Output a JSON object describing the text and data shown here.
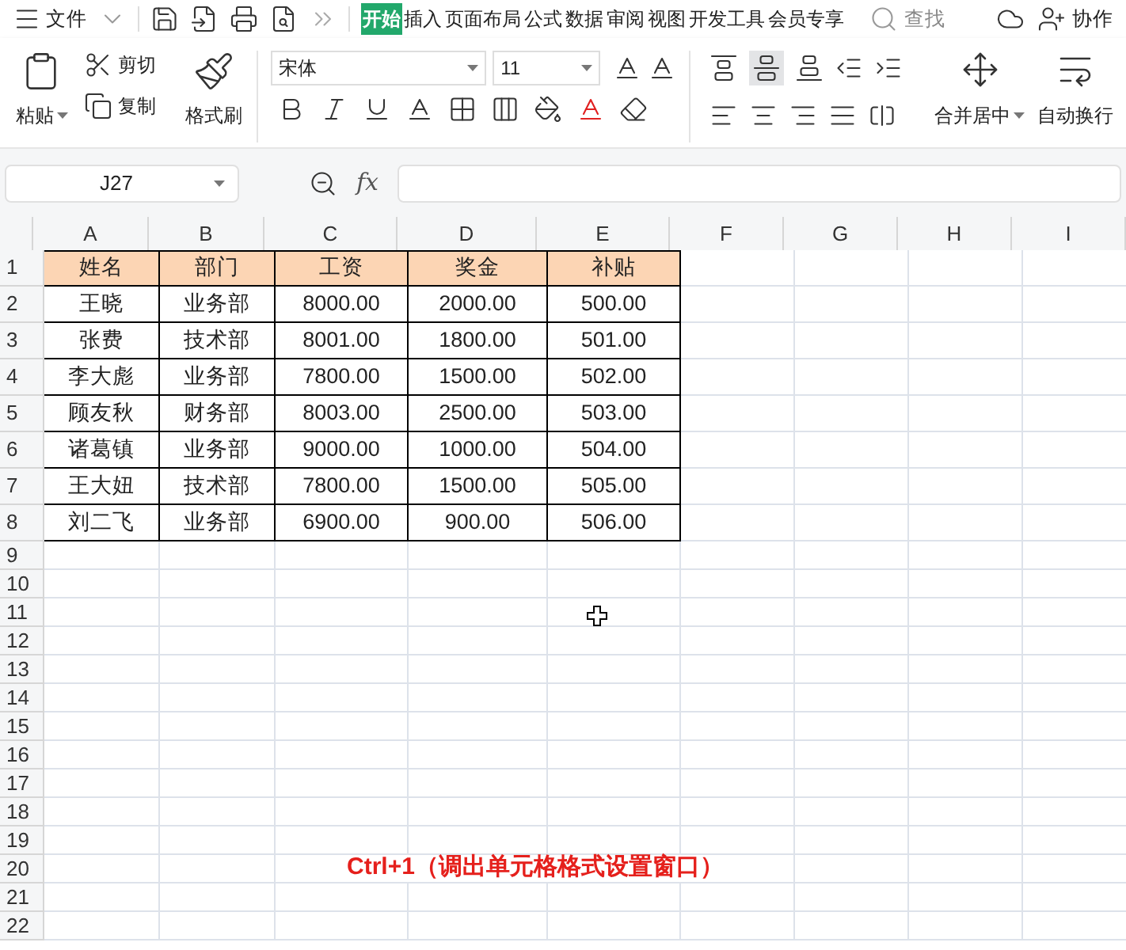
{
  "menu": {
    "file": "文件",
    "tabs": [
      {
        "label": "开始",
        "selected": true
      },
      {
        "label": "插入",
        "selected": false
      },
      {
        "label": "页面布局",
        "selected": false
      },
      {
        "label": "公式",
        "selected": false
      },
      {
        "label": "数据",
        "selected": false
      },
      {
        "label": "审阅",
        "selected": false
      },
      {
        "label": "视图",
        "selected": false
      },
      {
        "label": "开发工具",
        "selected": false
      },
      {
        "label": "会员专享",
        "selected": false
      }
    ],
    "search": "查找",
    "collab": "协作"
  },
  "ribbon": {
    "paste": "粘贴",
    "cut": "剪切",
    "copy": "复制",
    "format_painter": "格式刷",
    "font": "宋体",
    "size": "11",
    "merge": "合并居中",
    "wrap": "自动换行"
  },
  "formula_bar": {
    "name_box": "J27",
    "fx": "fx"
  },
  "sheet": {
    "columns": [
      "A",
      "B",
      "C",
      "D",
      "E",
      "F",
      "G",
      "H",
      "I"
    ],
    "row_numbers": [
      "1",
      "2",
      "3",
      "4",
      "5",
      "6",
      "7",
      "8",
      "9",
      "10",
      "11",
      "12",
      "13",
      "14",
      "15",
      "16",
      "17",
      "18",
      "19",
      "20",
      "21",
      "22"
    ],
    "header": [
      "姓名",
      "部门",
      "工资",
      "奖金",
      "补贴"
    ],
    "rows": [
      [
        "王晓",
        "业务部",
        "8000.00",
        "2000.00",
        "500.00"
      ],
      [
        "张费",
        "技术部",
        "8001.00",
        "1800.00",
        "501.00"
      ],
      [
        "李大彪",
        "业务部",
        "7800.00",
        "1500.00",
        "502.00"
      ],
      [
        "顾友秋",
        "财务部",
        "8003.00",
        "2500.00",
        "503.00"
      ],
      [
        "诸葛镇",
        "业务部",
        "9000.00",
        "1000.00",
        "504.00"
      ],
      [
        "王大妞",
        "技术部",
        "7800.00",
        "1500.00",
        "505.00"
      ],
      [
        "刘二飞",
        "业务部",
        "6900.00",
        "900.00",
        "506.00"
      ]
    ]
  },
  "caption": "Ctrl+1（调出单元格格式设置窗口）"
}
